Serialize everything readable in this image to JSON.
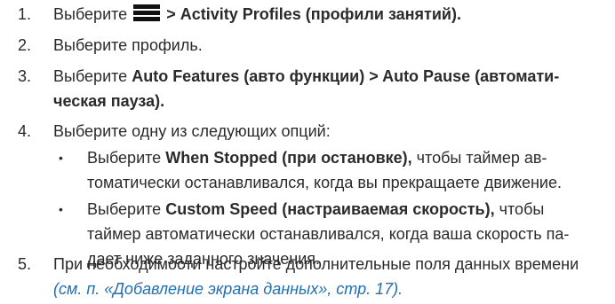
{
  "steps": [
    {
      "num": "1.",
      "pre": "Выберите",
      "bold": "> Activity Profiles (профили занятий).",
      "icon": "menu-icon"
    },
    {
      "num": "2.",
      "text": "Выберите профиль."
    },
    {
      "num": "3.",
      "pre": "Выберите",
      "bold1": "Auto Features (авто функции) > Auto Pause (автомати-",
      "bold2": "ческая пауза)."
    },
    {
      "num": "4.",
      "text": "Выберите одну из следующих опций:"
    },
    {
      "num": "5.",
      "line1": "При необходимости настройте дополнительные поля данных времени",
      "ref": "(см. п. «Добавление экрана данных», стр. 17)."
    }
  ],
  "bullets": [
    {
      "dot": "•",
      "pre": "Выберите",
      "bold": "When Stopped (при остановке),",
      "post": "чтобы таймер ав-",
      "line2": "томатически останавливался, когда вы прекращаете движение."
    },
    {
      "dot": "•",
      "pre": "Выберите",
      "bold": "Custom Speed (настраиваемая скорость),",
      "post": "чтобы",
      "line2": "таймер автоматически останавливался, когда ваша скорость па-",
      "line3": "дает ниже заданного значения."
    }
  ]
}
